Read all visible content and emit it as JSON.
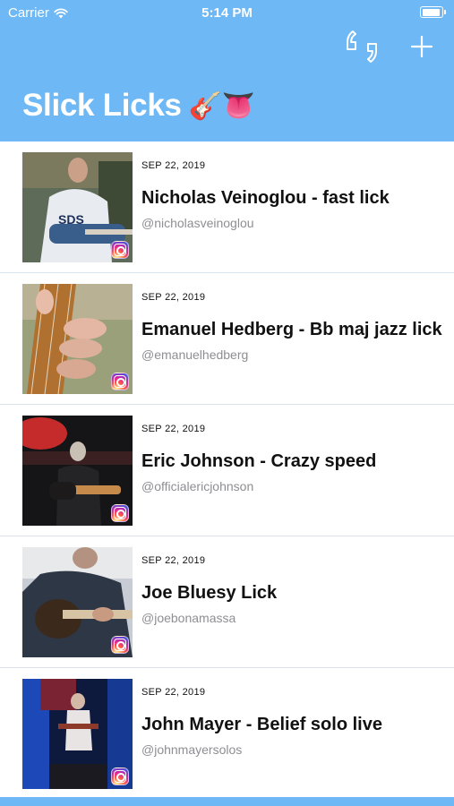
{
  "status_bar": {
    "carrier": "Carrier",
    "time": "5:14 PM"
  },
  "app": {
    "title": "Slick Licks",
    "emoji": "🎸👅"
  },
  "nav": {
    "quote_icon": "quote-icon",
    "add_icon": "plus-icon"
  },
  "colors": {
    "header": "#6eb8f5",
    "text": "#111111",
    "subtext": "#8e8e93"
  },
  "licks": [
    {
      "date": "SEP 22, 2019",
      "title": "Nicholas Veinoglou - fast lick",
      "handle": "@nicholasveinoglou"
    },
    {
      "date": "SEP 22, 2019",
      "title": "Emanuel Hedberg - Bb maj jazz lick",
      "handle": "@emanuelhedberg"
    },
    {
      "date": "SEP 22, 2019",
      "title": "Eric Johnson - Crazy speed",
      "handle": "@officialericjohnson"
    },
    {
      "date": "SEP 22, 2019",
      "title": "Joe Bluesy Lick",
      "handle": "@joebonamassa"
    },
    {
      "date": "SEP 22, 2019",
      "title": "John Mayer - Belief solo live",
      "handle": "@johnmayersolos"
    }
  ]
}
